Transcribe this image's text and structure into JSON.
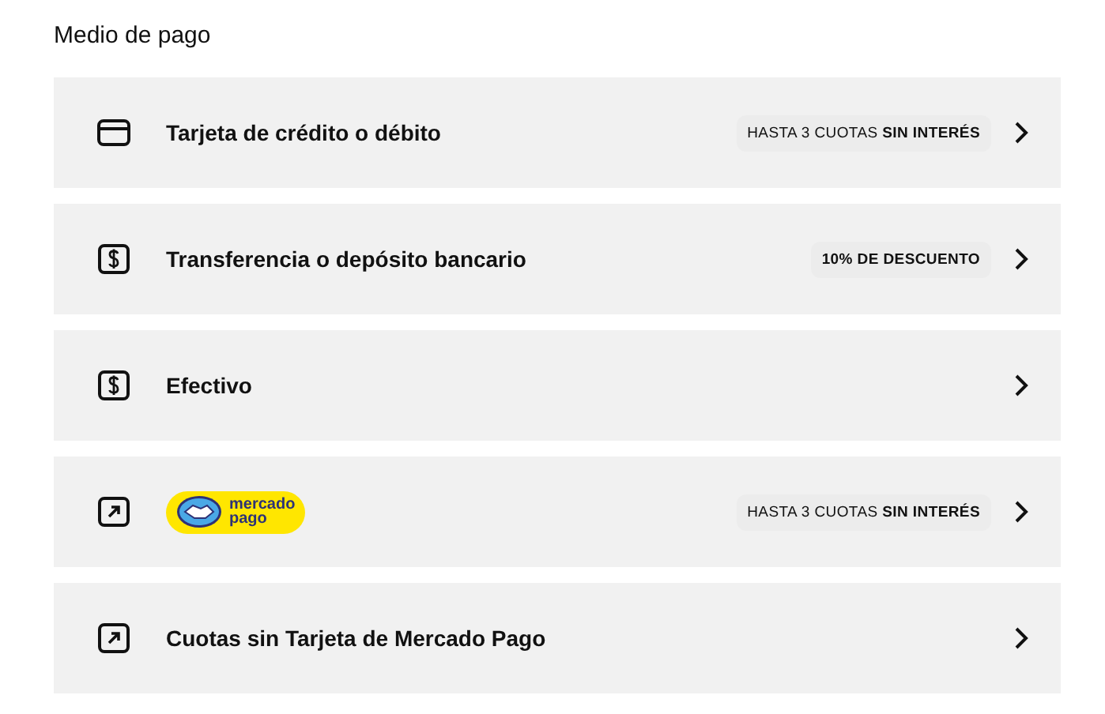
{
  "title": "Medio de pago",
  "options": [
    {
      "icon": {
        "kind": "card"
      },
      "kind": "text",
      "label": "Tarjeta de crédito o débito",
      "badge": {
        "text": "HASTA 3 CUOTAS **SIN INTERÉS**",
        "bold": false
      }
    },
    {
      "icon": {
        "kind": "cash"
      },
      "kind": "text",
      "label": "Transferencia o depósito bancario",
      "badge": {
        "text": "10% DE DESCUENTO",
        "bold": true
      }
    },
    {
      "icon": {
        "kind": "cash"
      },
      "kind": "text",
      "label": "Efectivo"
    },
    {
      "icon": {
        "kind": "external"
      },
      "kind": "logo",
      "label": "mercado pago",
      "badge": {
        "text": "HASTA 3 CUOTAS **SIN INTERÉS**",
        "bold": false
      }
    },
    {
      "icon": {
        "kind": "external"
      },
      "kind": "text",
      "label": "Cuotas sin Tarjeta de Mercado Pago"
    }
  ]
}
